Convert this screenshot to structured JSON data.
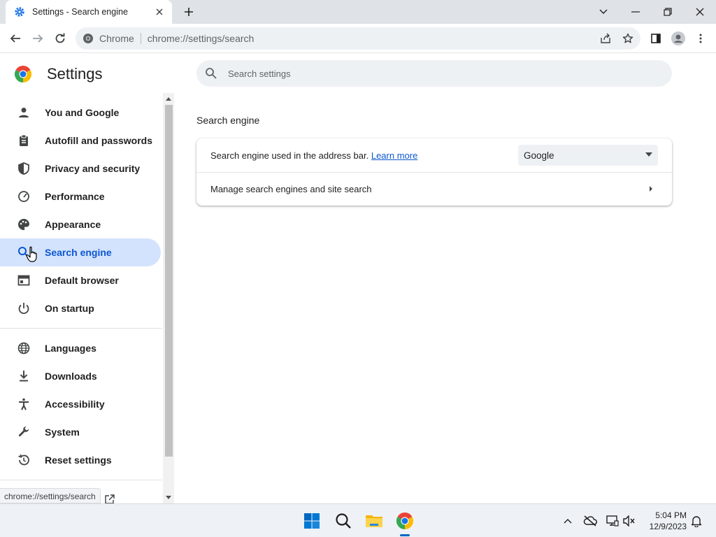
{
  "browser": {
    "tab_title": "Settings - Search engine",
    "omnibox_site": "Chrome",
    "omnibox_url": "chrome://settings/search"
  },
  "settings": {
    "title": "Settings",
    "search_placeholder": "Search settings",
    "nav_items": [
      {
        "label": "You and Google",
        "icon": "person-icon"
      },
      {
        "label": "Autofill and passwords",
        "icon": "clipboard-icon"
      },
      {
        "label": "Privacy and security",
        "icon": "shield-icon"
      },
      {
        "label": "Performance",
        "icon": "speedometer-icon"
      },
      {
        "label": "Appearance",
        "icon": "palette-icon"
      },
      {
        "label": "Search engine",
        "icon": "search-icon",
        "active": true
      },
      {
        "label": "Default browser",
        "icon": "browser-window-icon"
      },
      {
        "label": "On startup",
        "icon": "power-icon"
      },
      {
        "label": "Languages",
        "icon": "globe-icon"
      },
      {
        "label": "Downloads",
        "icon": "download-icon"
      },
      {
        "label": "Accessibility",
        "icon": "accessibility-icon"
      },
      {
        "label": "System",
        "icon": "wrench-icon"
      },
      {
        "label": "Reset settings",
        "icon": "history-icon"
      }
    ],
    "section_title": "Search engine",
    "row1_text": "Search engine used in the address bar.",
    "learn_more": "Learn more",
    "engine_selected": "Google",
    "row2_text": "Manage search engines and site search"
  },
  "status_bar": {
    "url": "chrome://settings/search"
  },
  "taskbar": {
    "time": "5:04 PM",
    "date": "12/9/2023"
  },
  "colors": {
    "accent": "#0b57d0",
    "active_nav_bg": "#d3e3fd",
    "tabstrip": "#dfe3e7"
  }
}
